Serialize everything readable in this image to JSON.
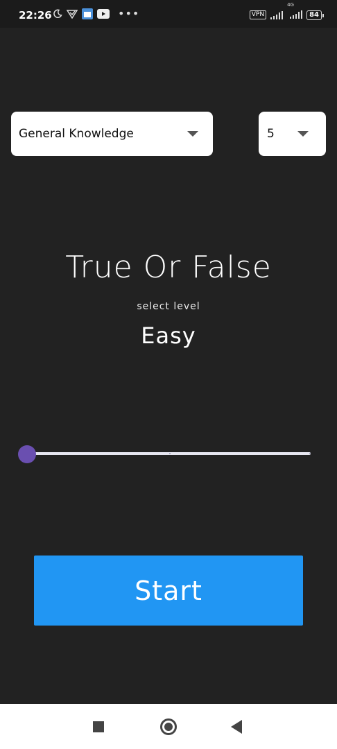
{
  "status_bar": {
    "time": "22:26",
    "vpn": "VPN",
    "network": "4G",
    "battery": "84"
  },
  "quiz": {
    "category": "General Knowledge",
    "question_count": "5",
    "title": "True Or False",
    "select_level_label": "select level",
    "level": "Easy",
    "level_slider_value": 0,
    "start_label": "Start"
  },
  "colors": {
    "background": "#222222",
    "start_button": "#2196f3",
    "slider_thumb": "#6a4fb0"
  }
}
